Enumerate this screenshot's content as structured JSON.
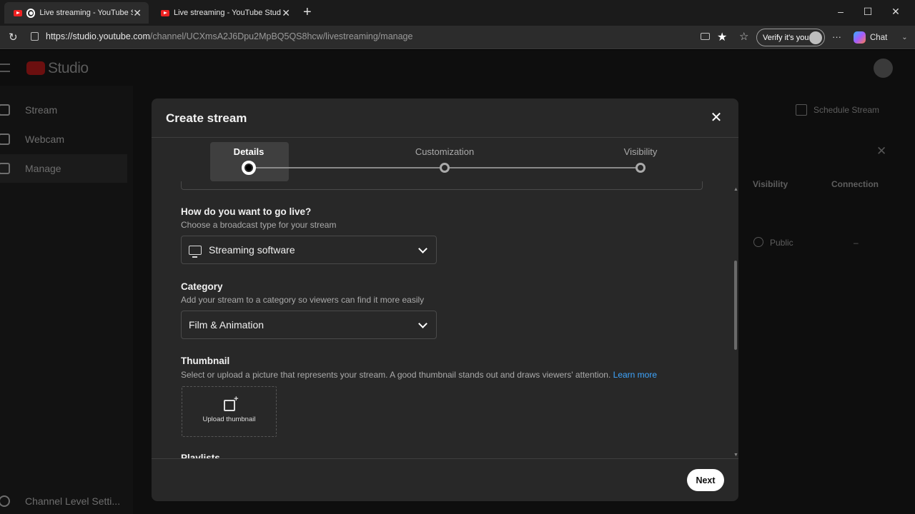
{
  "browser": {
    "tabs": [
      {
        "title": "Live streaming - YouTube Stud",
        "active": true
      },
      {
        "title": "Live streaming - YouTube Studio",
        "active": false
      }
    ],
    "new_tab": "+",
    "url_host": "https://studio.youtube.com",
    "url_path": "/channel/UCXmsA2J6Dpu2MpBQ5QS8hcw/livestreaming/manage",
    "verify_label": "Verify it's you",
    "more": "···",
    "chat_label": "Chat"
  },
  "studio": {
    "logo": "Studio",
    "sidebar": [
      {
        "label": "Stream"
      },
      {
        "label": "Webcam"
      },
      {
        "label": "Manage"
      }
    ],
    "sidebar_bottom": "Channel Level Setti...",
    "schedule_stream": "Schedule Stream",
    "table_headers": {
      "visibility": "Visibility",
      "connection": "Connection"
    },
    "row": {
      "visibility": "Public",
      "connection": "–"
    }
  },
  "modal": {
    "title": "Create stream",
    "steps": [
      {
        "label": "Details",
        "current": true
      },
      {
        "label": "Customization",
        "current": false
      },
      {
        "label": "Visibility",
        "current": false
      }
    ],
    "go_live": {
      "title": "How do you want to go live?",
      "subtitle": "Choose a broadcast type for your stream",
      "value": "Streaming software"
    },
    "category": {
      "title": "Category",
      "subtitle": "Add your stream to a category so viewers can find it more easily",
      "value": "Film & Animation"
    },
    "thumbnail": {
      "title": "Thumbnail",
      "subtitle": "Select or upload a picture that represents your stream. A good thumbnail stands out and draws viewers' attention.",
      "learn_more": "Learn more",
      "upload_label": "Upload thumbnail"
    },
    "playlists_title": "Playlists",
    "next_label": "Next"
  }
}
